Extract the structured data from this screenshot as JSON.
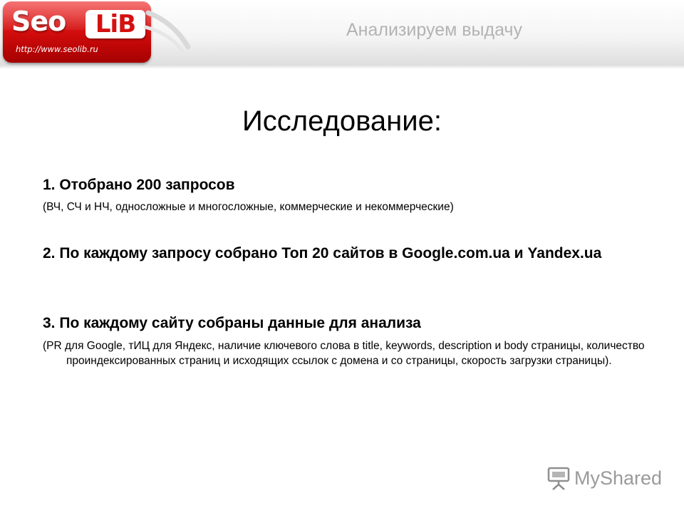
{
  "header": {
    "logo": {
      "brand_seo": "Seo",
      "brand_lib": "LiB",
      "url": "http://www.seolib.ru"
    },
    "title": "Анализируем выдачу"
  },
  "slide": {
    "title": "Исследование:",
    "items": [
      {
        "heading": "1. Отобрано 200 запросов",
        "detail": "(ВЧ, СЧ и НЧ, односложные и многосложные, коммерческие и некоммерческие)"
      },
      {
        "heading": "2. По каждому запросу собрано Топ 20 сайтов в Google.com.ua и Yandex.ua",
        "detail": ""
      },
      {
        "heading": "3. По каждому сайту собраны данные для анализа",
        "detail": "(PR для Google, тИЦ для Яндекс, наличие ключевого слова в title, keywords, description и body страницы, количество проиндексированных страниц и исходящих ссылок с домена и со страницы, скорость загрузки страницы)."
      }
    ]
  },
  "watermark": {
    "text": "MyShared",
    "icon": "presentation-board-icon"
  },
  "colors": {
    "logo_red": "#cf0b0b",
    "header_title_gray": "#b3b3b3",
    "text": "#000000",
    "watermark_gray": "#9a9a9a"
  }
}
